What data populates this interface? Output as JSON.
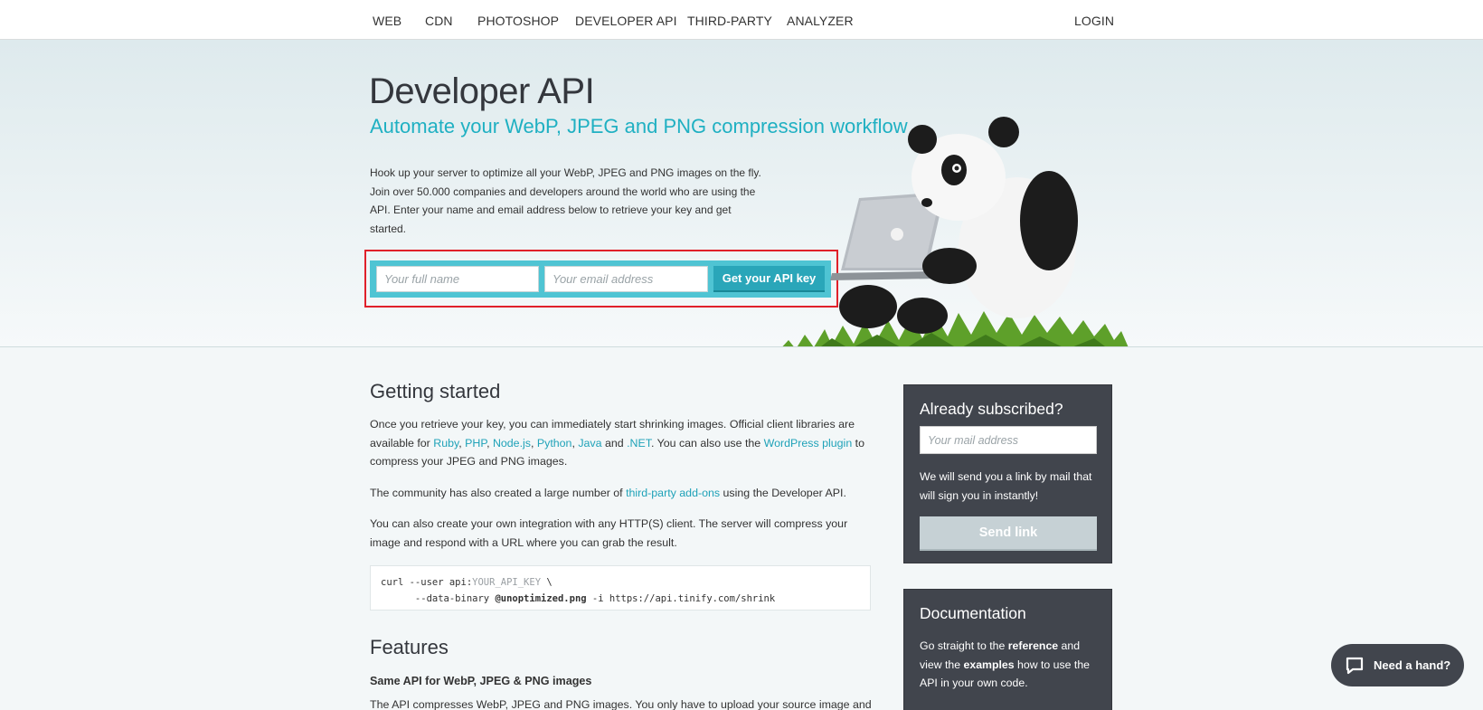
{
  "nav": {
    "items": [
      "WEB",
      "CDN",
      "PHOTOSHOP",
      "DEVELOPER API",
      "THIRD-PARTY",
      "ANALYZER"
    ],
    "login": "LOGIN"
  },
  "hero": {
    "title": "Developer API",
    "subtitle": "Automate your WebP, JPEG and PNG compression workflow",
    "description": "Hook up your server to optimize all your WebP, JPEG and PNG images on the fly. Join over 50.000 companies and developers around the world who are using the API. Enter your name and email address below to retrieve your key and get started.",
    "name_placeholder": "Your full name",
    "email_placeholder": "Your email address",
    "button": "Get your API key"
  },
  "getting_started": {
    "title": "Getting started",
    "p1_a": "Once you retrieve your key, you can immediately start shrinking images. Official client libraries are available for ",
    "lib_ruby": "Ruby",
    "lib_php": "PHP",
    "lib_node": "Node.js",
    "lib_python": "Python",
    "lib_java": "Java",
    "p1_and": " and ",
    "lib_net": ".NET",
    "p1_b": ". You can also use the ",
    "wordpress": "WordPress plugin",
    "p1_c": " to compress your JPEG and PNG images.",
    "p2_a": "The community has also created a large number of ",
    "addons": "third-party add-ons",
    "p2_b": " using the Developer API.",
    "p3": "You can also create your own integration with any HTTP(S) client. The server will compress your image and respond with a URL where you can grab the result.",
    "code_l1a": "curl --user api:",
    "code_l1b": "YOUR_API_KEY",
    "code_l1c": " \\",
    "code_l2a": "      --data-binary ",
    "code_l2b": "@unoptimized.png",
    "code_l2c": " -i https://api.tinify.com/shrink"
  },
  "features": {
    "title": "Features",
    "item_title": "Same API for WebP, JPEG & PNG images",
    "item_text": "The API compresses WebP, JPEG and PNG images. You only have to upload your source image and"
  },
  "subscribed": {
    "title": "Already subscribed?",
    "placeholder": "Your mail address",
    "text": "We will send you a link by mail that will sign you in instantly!",
    "button": "Send link"
  },
  "documentation": {
    "title": "Documentation",
    "t1": "Go straight to the ",
    "reference": "reference",
    "t2": " and view the ",
    "examples": "examples",
    "t3": " how to use the API in your own code."
  },
  "chat": {
    "label": "Need a hand?"
  },
  "colors": {
    "accent": "#1fb0c2",
    "form_bar": "#4fc4d3",
    "card": "#41454d",
    "highlight": "#e0202a"
  }
}
